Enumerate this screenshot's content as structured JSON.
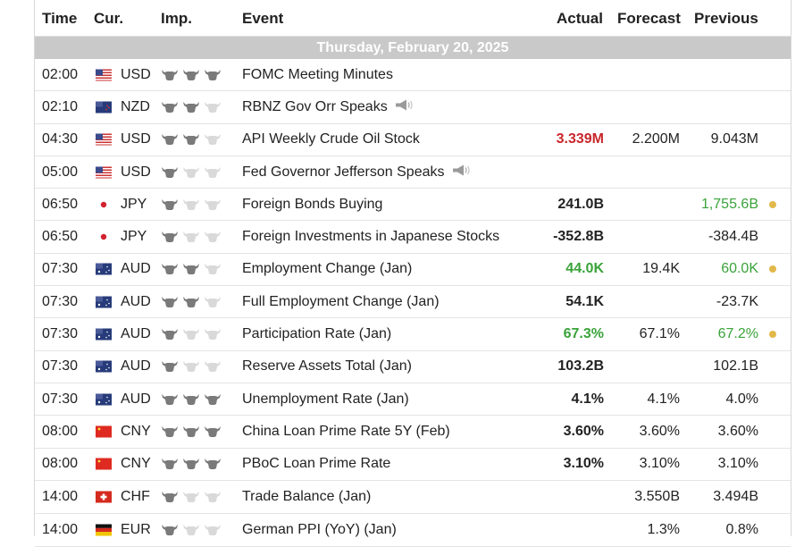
{
  "header": {
    "time": "Time",
    "currency": "Cur.",
    "importance": "Imp.",
    "event": "Event",
    "actual": "Actual",
    "forecast": "Forecast",
    "previous": "Previous"
  },
  "day_label": "Thursday, February 20, 2025",
  "colors": {
    "negative": "#c8262b",
    "positive": "#3aa33a",
    "day_bar": "#c9c9c9",
    "dot": "#e2b84a",
    "bull_on": "#7a7a7a",
    "bull_off": "#d9d9d9"
  },
  "rows": [
    {
      "time": "02:00",
      "cur": "USD",
      "flag": "us-flag-icon",
      "imp": 3,
      "event": "FOMC Meeting Minutes",
      "speech": false,
      "actual": "",
      "actual_color": "",
      "forecast": "",
      "previous": "",
      "prev_color": "",
      "dot": false
    },
    {
      "time": "02:10",
      "cur": "NZD",
      "flag": "nz-flag-icon",
      "imp": 2,
      "event": "RBNZ Gov Orr Speaks",
      "speech": true,
      "actual": "",
      "actual_color": "",
      "forecast": "",
      "previous": "",
      "prev_color": "",
      "dot": false
    },
    {
      "time": "04:30",
      "cur": "USD",
      "flag": "us-flag-icon",
      "imp": 2,
      "event": "API Weekly Crude Oil Stock",
      "speech": false,
      "actual": "3.339M",
      "actual_color": "red",
      "forecast": "2.200M",
      "previous": "9.043M",
      "prev_color": "",
      "dot": false
    },
    {
      "time": "05:00",
      "cur": "USD",
      "flag": "us-flag-icon",
      "imp": 1,
      "event": "Fed Governor Jefferson Speaks",
      "speech": true,
      "actual": "",
      "actual_color": "",
      "forecast": "",
      "previous": "",
      "prev_color": "",
      "dot": false
    },
    {
      "time": "06:50",
      "cur": "JPY",
      "flag": "jp-flag-icon",
      "imp": 1,
      "event": "Foreign Bonds Buying",
      "speech": false,
      "actual": "241.0B",
      "actual_color": "",
      "forecast": "",
      "previous": "1,755.6B",
      "prev_color": "green",
      "dot": true
    },
    {
      "time": "06:50",
      "cur": "JPY",
      "flag": "jp-flag-icon",
      "imp": 1,
      "event": "Foreign Investments in Japanese Stocks",
      "speech": false,
      "actual": "-352.8B",
      "actual_color": "",
      "forecast": "",
      "previous": "-384.4B",
      "prev_color": "",
      "dot": false
    },
    {
      "time": "07:30",
      "cur": "AUD",
      "flag": "au-flag-icon",
      "imp": 2,
      "event": "Employment Change (Jan)",
      "speech": false,
      "actual": "44.0K",
      "actual_color": "green",
      "forecast": "19.4K",
      "previous": "60.0K",
      "prev_color": "green",
      "dot": true
    },
    {
      "time": "07:30",
      "cur": "AUD",
      "flag": "au-flag-icon",
      "imp": 2,
      "event": "Full Employment Change (Jan)",
      "speech": false,
      "actual": "54.1K",
      "actual_color": "",
      "forecast": "",
      "previous": "-23.7K",
      "prev_color": "",
      "dot": false
    },
    {
      "time": "07:30",
      "cur": "AUD",
      "flag": "au-flag-icon",
      "imp": 1,
      "event": "Participation Rate (Jan)",
      "speech": false,
      "actual": "67.3%",
      "actual_color": "green",
      "forecast": "67.1%",
      "previous": "67.2%",
      "prev_color": "green",
      "dot": true
    },
    {
      "time": "07:30",
      "cur": "AUD",
      "flag": "au-flag-icon",
      "imp": 1,
      "event": "Reserve Assets Total (Jan)",
      "speech": false,
      "actual": "103.2B",
      "actual_color": "",
      "forecast": "",
      "previous": "102.1B",
      "prev_color": "",
      "dot": false
    },
    {
      "time": "07:30",
      "cur": "AUD",
      "flag": "au-flag-icon",
      "imp": 3,
      "event": "Unemployment Rate (Jan)",
      "speech": false,
      "actual": "4.1%",
      "actual_color": "",
      "forecast": "4.1%",
      "previous": "4.0%",
      "prev_color": "",
      "dot": false
    },
    {
      "time": "08:00",
      "cur": "CNY",
      "flag": "cn-flag-icon",
      "imp": 3,
      "event": "China Loan Prime Rate 5Y (Feb)",
      "speech": false,
      "actual": "3.60%",
      "actual_color": "",
      "forecast": "3.60%",
      "previous": "3.60%",
      "prev_color": "",
      "dot": false
    },
    {
      "time": "08:00",
      "cur": "CNY",
      "flag": "cn-flag-icon",
      "imp": 3,
      "event": "PBoC Loan Prime Rate",
      "speech": false,
      "actual": "3.10%",
      "actual_color": "",
      "forecast": "3.10%",
      "previous": "3.10%",
      "prev_color": "",
      "dot": false
    },
    {
      "time": "14:00",
      "cur": "CHF",
      "flag": "ch-flag-icon",
      "imp": 1,
      "event": "Trade Balance (Jan)",
      "speech": false,
      "actual": "",
      "actual_color": "",
      "forecast": "3.550B",
      "previous": "3.494B",
      "prev_color": "",
      "dot": false
    },
    {
      "time": "14:00",
      "cur": "EUR",
      "flag": "de-flag-icon",
      "imp": 1,
      "event": "German PPI (YoY) (Jan)",
      "speech": false,
      "actual": "",
      "actual_color": "",
      "forecast": "1.3%",
      "previous": "0.8%",
      "prev_color": "",
      "dot": false
    }
  ]
}
